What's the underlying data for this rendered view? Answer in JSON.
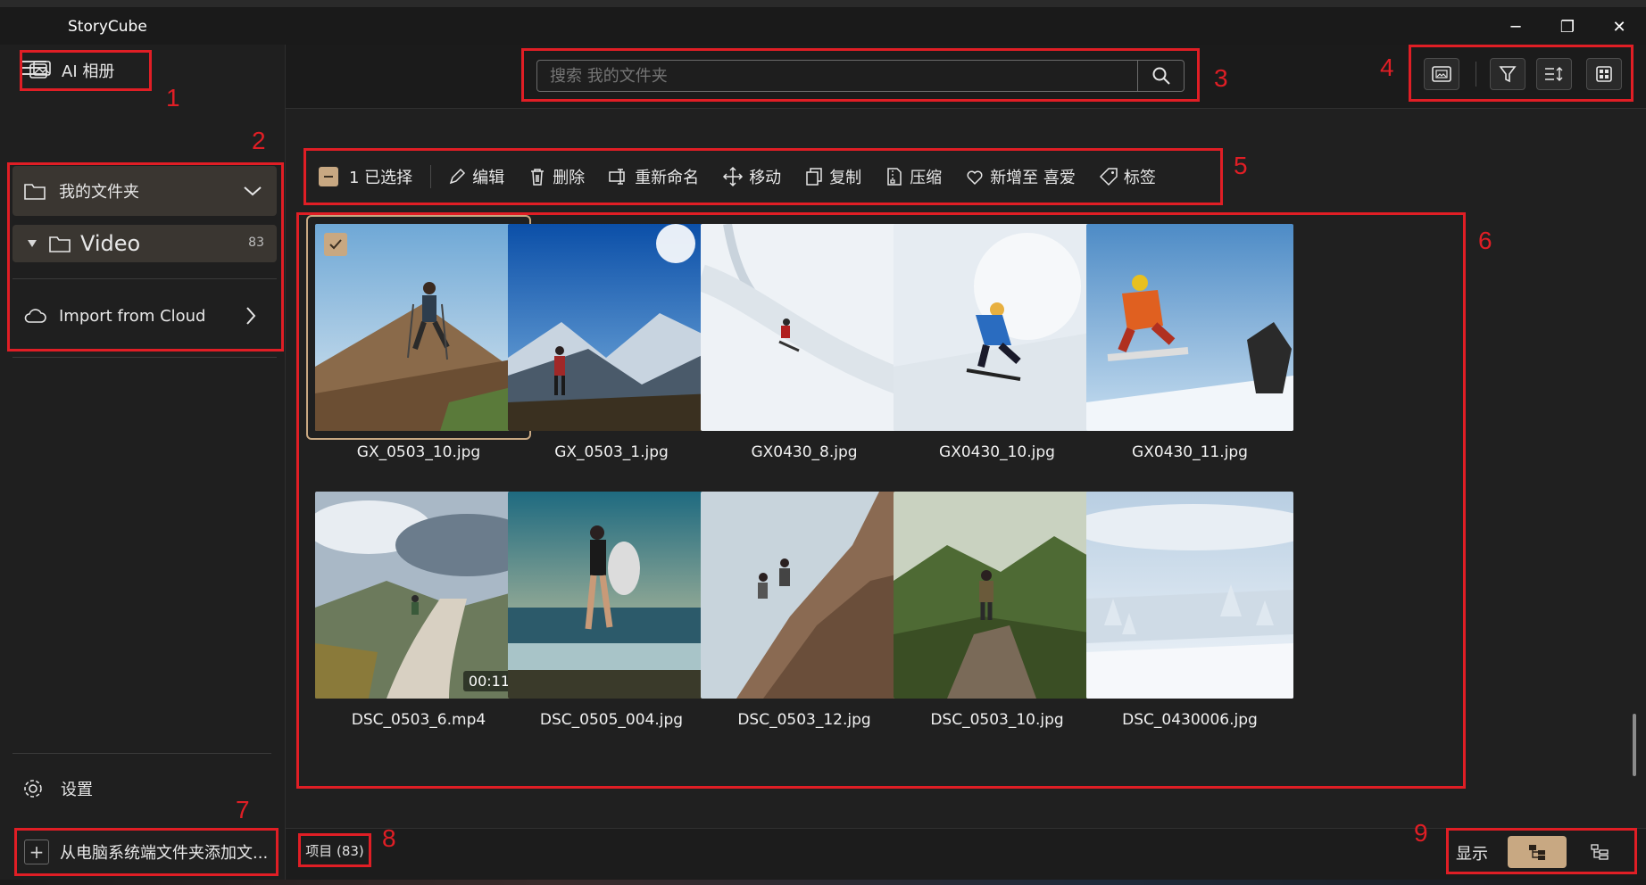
{
  "app": {
    "title": "StoryCube"
  },
  "window_controls": {
    "minimize": "─",
    "maximize": "❐",
    "close": "✕"
  },
  "sidebar": {
    "ai_album_label": "AI 相册",
    "my_folder_label": "我的文件夹",
    "video_folder": {
      "label": "Video",
      "count": "83"
    },
    "cloud_label": "Import from Cloud",
    "settings_label": "设置",
    "add_folder_label": "从电脑系统端文件夹添加文..."
  },
  "search": {
    "placeholder": "搜索 我的文件夹"
  },
  "toolbar": {
    "icons": [
      "slideshow-icon",
      "filter-icon",
      "sort-icon",
      "grid-view-icon"
    ]
  },
  "actions": {
    "selected": "1 已选择",
    "edit": "编辑",
    "delete": "删除",
    "rename": "重新命名",
    "move": "移动",
    "copy": "复制",
    "compress": "压缩",
    "favorite": "新增至 喜爱",
    "tag": "标签"
  },
  "files": [
    {
      "name": "GX_0503_10.jpg",
      "selected": true
    },
    {
      "name": "GX_0503_1.jpg"
    },
    {
      "name": "GX0430_8.jpg"
    },
    {
      "name": "GX0430_10.jpg"
    },
    {
      "name": "GX0430_11.jpg"
    },
    {
      "name": "DSC_0503_6.mp4",
      "duration": "00:11"
    },
    {
      "name": "DSC_0505_004.jpg"
    },
    {
      "name": "DSC_0503_12.jpg"
    },
    {
      "name": "DSC_0503_10.jpg"
    },
    {
      "name": "DSC_0430006.jpg"
    }
  ],
  "status": {
    "items": "项目 (83)",
    "display_label": "显示"
  },
  "annotations": [
    "1",
    "2",
    "3",
    "4",
    "5",
    "6",
    "7",
    "8",
    "9"
  ],
  "colors": {
    "accent": "#c8a882",
    "highlight_box": "#e01e25",
    "background": "#202020"
  }
}
